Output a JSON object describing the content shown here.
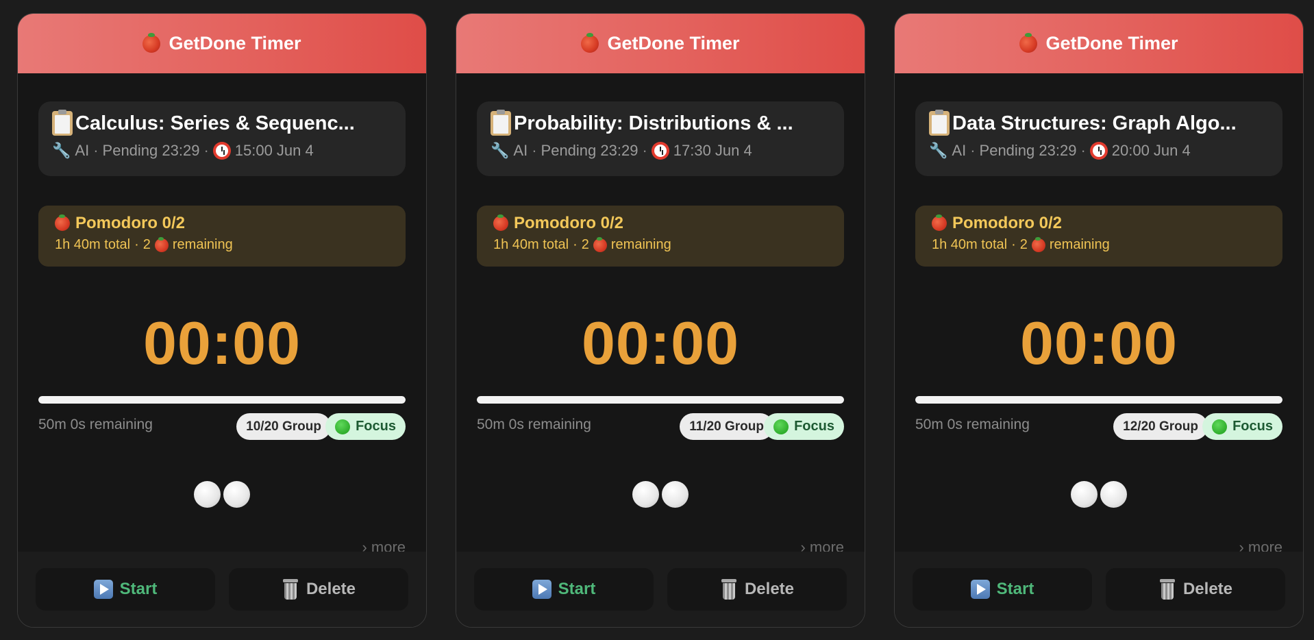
{
  "cards": [
    {
      "header_title": "GetDone Timer",
      "task_title": "Calculus: Series & Sequenc...",
      "meta_source": "AI",
      "meta_status": "Pending 23:29",
      "meta_due": "15:00 Jun 4",
      "pomodoro_title": "Pomodoro 0/2",
      "pomodoro_total": "1h 40m total",
      "pomodoro_count": "2",
      "pomodoro_remaining_label": "remaining",
      "timer": "00:00",
      "progress": 1.0,
      "remaining_text": "50m 0s remaining",
      "group_badge": "10/20 Group",
      "focus_badge": "Focus",
      "more_link": "› more",
      "start_label": "Start",
      "delete_label": "Delete"
    },
    {
      "header_title": "GetDone Timer",
      "task_title": "Probability: Distributions & ...",
      "meta_source": "AI",
      "meta_status": "Pending 23:29",
      "meta_due": "17:30 Jun 4",
      "pomodoro_title": "Pomodoro 0/2",
      "pomodoro_total": "1h 40m total",
      "pomodoro_count": "2",
      "pomodoro_remaining_label": "remaining",
      "timer": "00:00",
      "progress": 1.0,
      "remaining_text": "50m 0s remaining",
      "group_badge": "11/20 Group",
      "focus_badge": "Focus",
      "more_link": "› more",
      "start_label": "Start",
      "delete_label": "Delete"
    },
    {
      "header_title": "GetDone Timer",
      "task_title": "Data Structures: Graph Algo...",
      "meta_source": "AI",
      "meta_status": "Pending 23:29",
      "meta_due": "20:00 Jun 4",
      "pomodoro_title": "Pomodoro 0/2",
      "pomodoro_total": "1h 40m total",
      "pomodoro_count": "2",
      "pomodoro_remaining_label": "remaining",
      "timer": "00:00",
      "progress": 1.0,
      "remaining_text": "50m 0s remaining",
      "group_badge": "12/20 Group",
      "focus_badge": "Focus",
      "more_link": "› more",
      "start_label": "Start",
      "delete_label": "Delete"
    }
  ],
  "colors": {
    "header_gradient_start": "#e87976",
    "header_gradient_end": "#df4d48",
    "timer": "#e9a13a",
    "pomodoro_text": "#f3c85a",
    "pomodoro_bg": "#3a3220",
    "focus_bg": "#d4f5de",
    "start_text": "#4fb87a"
  },
  "icons": {
    "header": "tomato-icon",
    "task": "clipboard-icon",
    "source": "wrench-icon",
    "due": "alarm-clock-icon",
    "focus": "green-circle-icon",
    "sessions": "white-circle-icon",
    "start": "play-icon",
    "delete": "trash-icon"
  }
}
